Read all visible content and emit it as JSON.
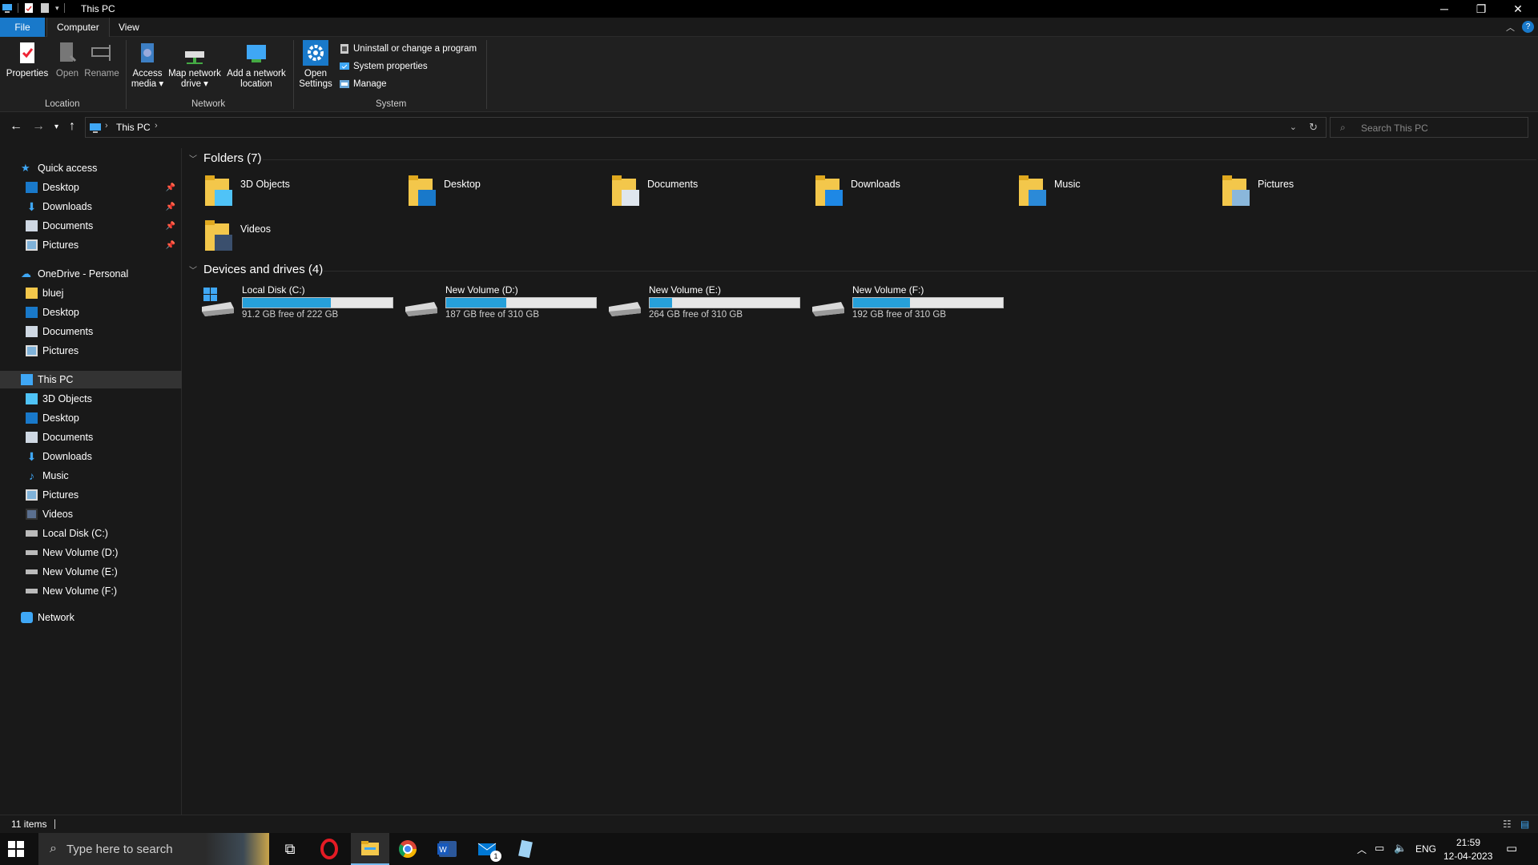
{
  "window": {
    "title": "This PC"
  },
  "ribbon_tabs": [
    "File",
    "Computer",
    "View"
  ],
  "ribbon": {
    "location": {
      "label": "Location",
      "properties": "Properties",
      "open": "Open",
      "rename": "Rename"
    },
    "network": {
      "label": "Network",
      "access_media_1": "Access",
      "access_media_2": "media ▾",
      "map_drive_1": "Map network",
      "map_drive_2": "drive ▾",
      "add_location_1": "Add a network",
      "add_location_2": "location"
    },
    "system": {
      "label": "System",
      "open_settings_1": "Open",
      "open_settings_2": "Settings",
      "uninstall": "Uninstall or change a program",
      "system_properties": "System properties",
      "manage": "Manage"
    }
  },
  "address": {
    "path_item": "This PC",
    "search_placeholder": "Search This PC"
  },
  "sidebar": {
    "quick_access": "Quick access",
    "quick_items": [
      "Desktop",
      "Downloads",
      "Documents",
      "Pictures"
    ],
    "onedrive": "OneDrive - Personal",
    "onedrive_items": [
      "bluej",
      "Desktop",
      "Documents",
      "Pictures"
    ],
    "this_pc": "This PC",
    "pc_items": [
      "3D Objects",
      "Desktop",
      "Documents",
      "Downloads",
      "Music",
      "Pictures",
      "Videos",
      "Local Disk (C:)",
      "New Volume (D:)",
      "New Volume (E:)",
      "New Volume (F:)"
    ],
    "network": "Network"
  },
  "folders": {
    "heading": "Folders (7)",
    "items": [
      "3D Objects",
      "Desktop",
      "Documents",
      "Downloads",
      "Music",
      "Pictures",
      "Videos"
    ]
  },
  "drives": {
    "heading": "Devices and drives (4)",
    "items": [
      {
        "name": "Local Disk (C:)",
        "free": "91.2 GB free of 222 GB",
        "used_fraction": 0.59
      },
      {
        "name": "New Volume (D:)",
        "free": "187 GB free of 310 GB",
        "used_fraction": 0.4
      },
      {
        "name": "New Volume (E:)",
        "free": "264 GB free of 310 GB",
        "used_fraction": 0.15
      },
      {
        "name": "New Volume (F:)",
        "free": "192 GB free of 310 GB",
        "used_fraction": 0.38
      }
    ]
  },
  "status": {
    "items": "11 items"
  },
  "taskbar": {
    "search_placeholder": "Type here to search",
    "time": "21:59",
    "date": "12-04-2023",
    "lang": "ENG",
    "mail_badge": "1"
  },
  "colors": {
    "accent": "#1979ca",
    "drive_fill": "#26a0da",
    "folder": "#f3c74b"
  }
}
